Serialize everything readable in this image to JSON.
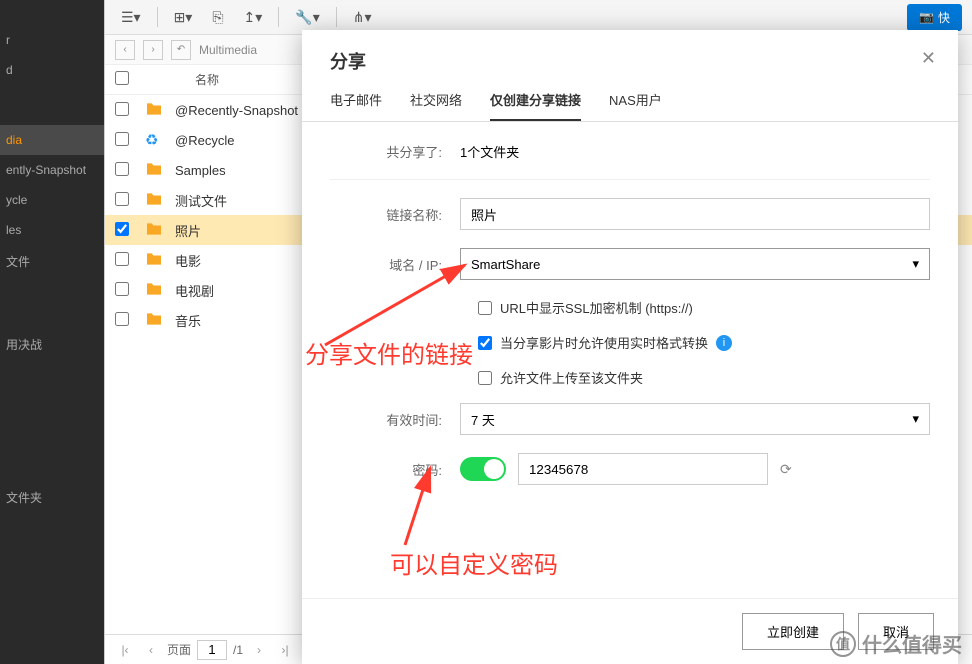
{
  "sidebar": {
    "items": [
      {
        "label": "r"
      },
      {
        "label": "d"
      },
      {
        "label": "dia",
        "active": true
      },
      {
        "label": "ently-Snapshot"
      },
      {
        "label": "ycle"
      },
      {
        "label": "les"
      },
      {
        "label": "文件"
      },
      {
        "label": ""
      },
      {
        "label": "用决战"
      },
      {
        "label": ""
      },
      {
        "label": "文件夹"
      }
    ]
  },
  "toolbar": {
    "quick": "快"
  },
  "breadcrumb": {
    "path": "Multimedia"
  },
  "fileHeader": {
    "name": "名称"
  },
  "files": [
    {
      "name": "@Recently-Snapshot",
      "icon": "folder"
    },
    {
      "name": "@Recycle",
      "icon": "recycle"
    },
    {
      "name": "Samples",
      "icon": "folder"
    },
    {
      "name": "测试文件",
      "icon": "folder"
    },
    {
      "name": "照片",
      "icon": "folder",
      "selected": true,
      "checked": true
    },
    {
      "name": "电影",
      "icon": "folder"
    },
    {
      "name": "电视剧",
      "icon": "folder"
    },
    {
      "name": "音乐",
      "icon": "folder"
    }
  ],
  "pagination": {
    "label": "页面",
    "current": "1",
    "total": "/1"
  },
  "modal": {
    "title": "分享",
    "tabs": [
      "电子邮件",
      "社交网络",
      "仅创建分享链接",
      "NAS用户"
    ],
    "activeTab": 2,
    "sharedLabel": "共分享了:",
    "sharedValue": "1个文件夹",
    "linkNameLabel": "链接名称:",
    "linkNameValue": "照片",
    "domainLabel": "域名 / IP:",
    "domainValue": "SmartShare",
    "sslLabel": "URL中显示SSL加密机制 (https://)",
    "transcodeLabel": "当分享影片时允许使用实时格式转换",
    "uploadLabel": "允许文件上传至该文件夹",
    "expireLabel": "有效时间:",
    "expireValue": "7 天",
    "passwordLabel": "密码:",
    "passwordValue": "12345678",
    "createBtn": "立即创建",
    "cancelBtn": "取消"
  },
  "annotations": {
    "a1": "分享文件的链接",
    "a2": "可以自定义密码"
  },
  "watermark": "什么值得买"
}
